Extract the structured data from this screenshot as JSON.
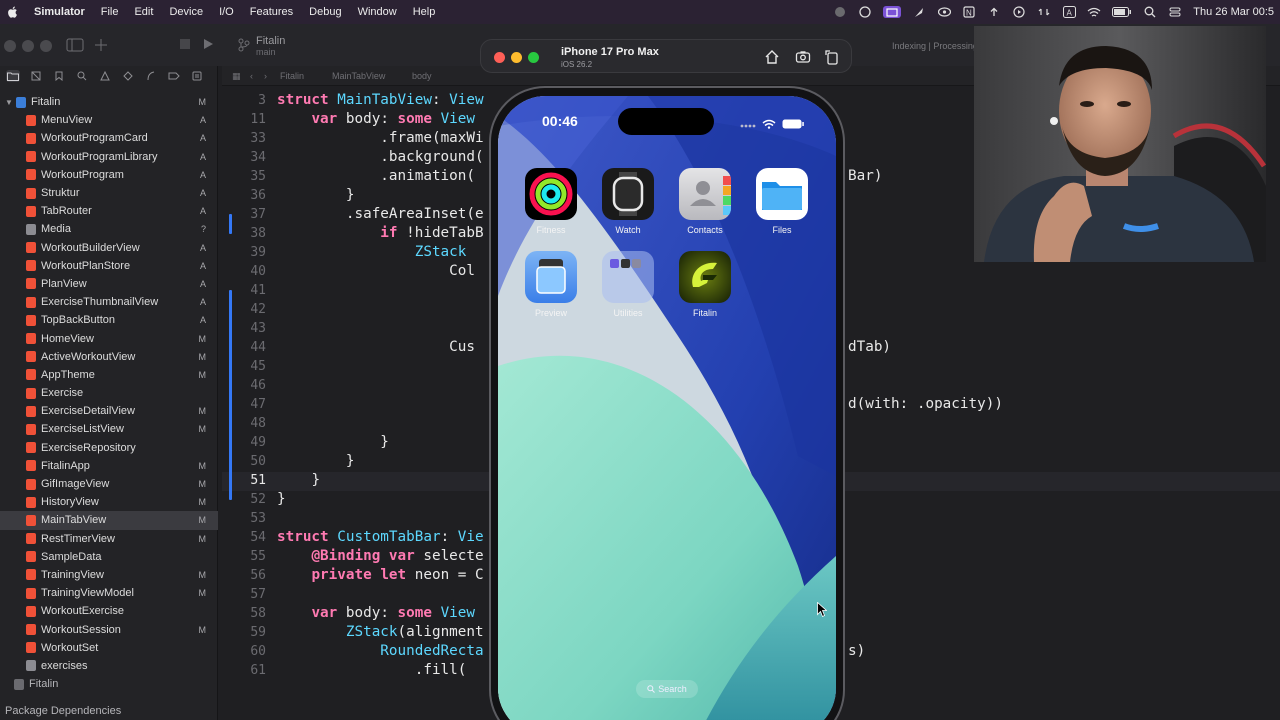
{
  "menubar": {
    "app_name": "Simulator",
    "items": [
      "File",
      "Edit",
      "Device",
      "I/O",
      "Features",
      "Debug",
      "Window",
      "Help"
    ],
    "clock": "Thu 26 Mar  00:5"
  },
  "xcode": {
    "project": "Fitalin",
    "branch": "main",
    "activity": "Indexing | Processing",
    "jumpbar": [
      "Fitalin",
      "MainTabView",
      "body"
    ],
    "package_dependencies": "Package Dependencies"
  },
  "navigator": {
    "root": "Fitalin",
    "root_badge": "M",
    "files": [
      {
        "name": "MenuView",
        "badge": "A"
      },
      {
        "name": "WorkoutProgramCard",
        "badge": "A"
      },
      {
        "name": "WorkoutProgramLibrary",
        "badge": "A"
      },
      {
        "name": "WorkoutProgram",
        "badge": "A"
      },
      {
        "name": "Struktur",
        "badge": "A"
      },
      {
        "name": "TabRouter",
        "badge": "A"
      },
      {
        "name": "Media",
        "badge": "?"
      },
      {
        "name": "WorkoutBuilderView",
        "badge": "A"
      },
      {
        "name": "WorkoutPlanStore",
        "badge": "A"
      },
      {
        "name": "PlanView",
        "badge": "A"
      },
      {
        "name": "ExerciseThumbnailView",
        "badge": "A"
      },
      {
        "name": "TopBackButton",
        "badge": "A"
      },
      {
        "name": "HomeView",
        "badge": "M"
      },
      {
        "name": "ActiveWorkoutView",
        "badge": "M"
      },
      {
        "name": "AppTheme",
        "badge": "M"
      },
      {
        "name": "Exercise",
        "badge": ""
      },
      {
        "name": "ExerciseDetailView",
        "badge": "M"
      },
      {
        "name": "ExerciseListView",
        "badge": "M"
      },
      {
        "name": "ExerciseRepository",
        "badge": ""
      },
      {
        "name": "FitalinApp",
        "badge": "M"
      },
      {
        "name": "GifImageView",
        "badge": "M"
      },
      {
        "name": "HistoryView",
        "badge": "M"
      },
      {
        "name": "MainTabView",
        "badge": "M"
      },
      {
        "name": "RestTimerView",
        "badge": "M"
      },
      {
        "name": "SampleData",
        "badge": ""
      },
      {
        "name": "TrainingView",
        "badge": "M"
      },
      {
        "name": "TrainingViewModel",
        "badge": "M"
      },
      {
        "name": "WorkoutExercise",
        "badge": ""
      },
      {
        "name": "WorkoutSession",
        "badge": "M"
      },
      {
        "name": "WorkoutSet",
        "badge": ""
      },
      {
        "name": "exercises",
        "badge": ""
      },
      {
        "name": "Fitalin",
        "badge": ""
      }
    ],
    "selected": "MainTabView"
  },
  "code": [
    {
      "ln": "3",
      "text": "struct MainTabView: View"
    },
    {
      "ln": "11",
      "text": "    var body: some View"
    },
    {
      "ln": "33",
      "text": "            .frame(maxWi"
    },
    {
      "ln": "34",
      "text": "            .background("
    },
    {
      "ln": "35",
      "text": "            .animation(",
      "right": "Bar)"
    },
    {
      "ln": "36",
      "text": "        }"
    },
    {
      "ln": "37",
      "text": "        .safeAreaInset(e"
    },
    {
      "ln": "38",
      "text": "            if !hideTabB"
    },
    {
      "ln": "39",
      "text": "                ZStack"
    },
    {
      "ln": "40",
      "text": "                    Col"
    },
    {
      "ln": "41",
      "text": ""
    },
    {
      "ln": "42",
      "text": ""
    },
    {
      "ln": "43",
      "text": ""
    },
    {
      "ln": "44",
      "text": "                    Cus",
      "right": "dTab)"
    },
    {
      "ln": "45",
      "text": ""
    },
    {
      "ln": "46",
      "text": ""
    },
    {
      "ln": "47",
      "text": "",
      "right": "d(with: .opacity))"
    },
    {
      "ln": "48",
      "text": ""
    },
    {
      "ln": "49",
      "text": "            }"
    },
    {
      "ln": "50",
      "text": "        }"
    },
    {
      "ln": "51",
      "text": "    }",
      "current": true
    },
    {
      "ln": "52",
      "text": "}"
    },
    {
      "ln": "53",
      "text": ""
    },
    {
      "ln": "54",
      "text": "struct CustomTabBar: Vie"
    },
    {
      "ln": "55",
      "text": "    @Binding var selecte"
    },
    {
      "ln": "56",
      "text": "    private let neon = C"
    },
    {
      "ln": "57",
      "text": ""
    },
    {
      "ln": "58",
      "text": "    var body: some View"
    },
    {
      "ln": "59",
      "text": "        ZStack(alignment"
    },
    {
      "ln": "60",
      "text": "            RoundedRecta",
      "right": "s)"
    },
    {
      "ln": "61",
      "text": "                .fill("
    }
  ],
  "simulator": {
    "device": "iPhone 17 Pro Max",
    "os": "iOS 26.2",
    "time": "00:46",
    "apps": [
      {
        "label": "Fitness",
        "icon": "fitness-icon"
      },
      {
        "label": "Watch",
        "icon": "watch-icon"
      },
      {
        "label": "Contacts",
        "icon": "contacts-icon"
      },
      {
        "label": "Files",
        "icon": "files-icon"
      },
      {
        "label": "Preview",
        "icon": "preview-icon"
      },
      {
        "label": "Utilities",
        "icon": "utilities-icon"
      },
      {
        "label": "Fitalin",
        "icon": "fitalin-icon"
      }
    ],
    "search": "Search"
  },
  "colors": {
    "keyword": "#ff7ab2",
    "type": "#5dd8ff",
    "selection": "#3b3b40",
    "accent": "#3478f6"
  }
}
